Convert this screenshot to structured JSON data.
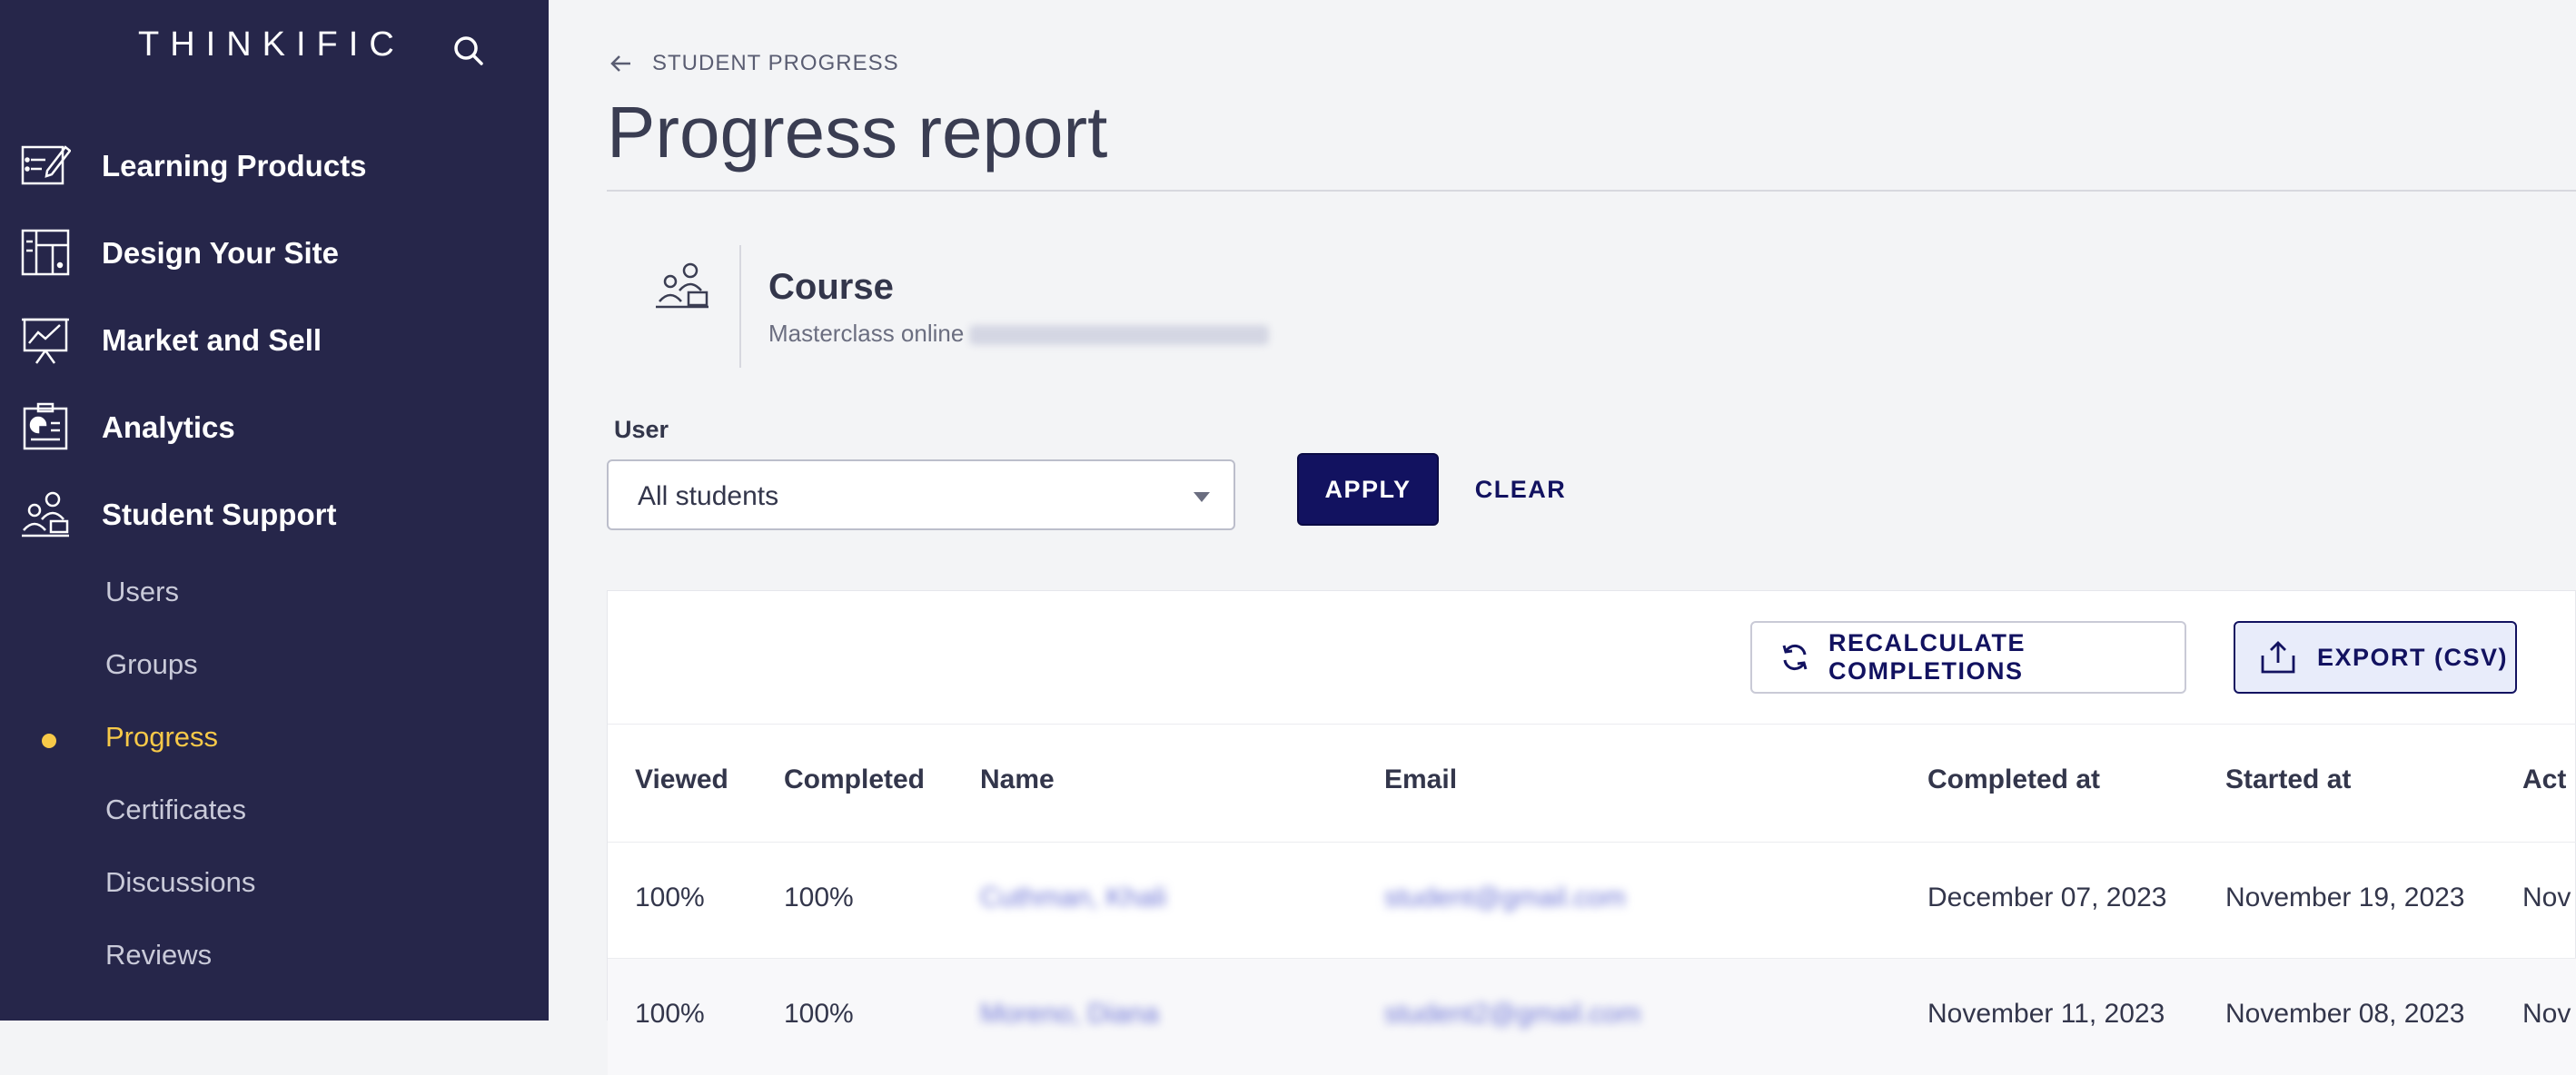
{
  "sidebar": {
    "brand": "THINKIFIC",
    "nav": [
      {
        "label": "Learning Products",
        "icon": "learning-products-icon"
      },
      {
        "label": "Design Your Site",
        "icon": "design-site-icon"
      },
      {
        "label": "Market and Sell",
        "icon": "market-sell-icon"
      },
      {
        "label": "Analytics",
        "icon": "analytics-icon"
      },
      {
        "label": "Student Support",
        "icon": "student-support-icon"
      }
    ],
    "sub": [
      {
        "label": "Users",
        "active": false
      },
      {
        "label": "Groups",
        "active": false
      },
      {
        "label": "Progress",
        "active": true
      },
      {
        "label": "Certificates",
        "active": false
      },
      {
        "label": "Discussions",
        "active": false
      },
      {
        "label": "Reviews",
        "active": false
      }
    ]
  },
  "header": {
    "back_label": "STUDENT PROGRESS",
    "title": "Progress report"
  },
  "course": {
    "type": "Course",
    "name": "Masterclass online"
  },
  "filter": {
    "user_label": "User",
    "selected": "All students",
    "apply_label": "APPLY",
    "clear_label": "CLEAR"
  },
  "table": {
    "recalc_label": "RECALCULATE COMPLETIONS",
    "export_label": "EXPORT (CSV)",
    "columns": [
      "Viewed",
      "Completed",
      "Name",
      "Email",
      "Completed at",
      "Started at",
      "Act"
    ],
    "rows": [
      {
        "viewed": "100%",
        "completed": "100%",
        "name": "Cuthman, Khali",
        "email": "student@gmail.com",
        "completed_at": "December 07, 2023",
        "started_at": "November 19, 2023",
        "activity": "Nov"
      },
      {
        "viewed": "100%",
        "completed": "100%",
        "name": "Moreno, Diana",
        "email": "student2@gmail.com",
        "completed_at": "November 11, 2023",
        "started_at": "November 08, 2023",
        "activity": "Nov"
      }
    ]
  },
  "colors": {
    "sidebar_bg": "#26264a",
    "accent": "#121260",
    "active": "#f7c948"
  }
}
